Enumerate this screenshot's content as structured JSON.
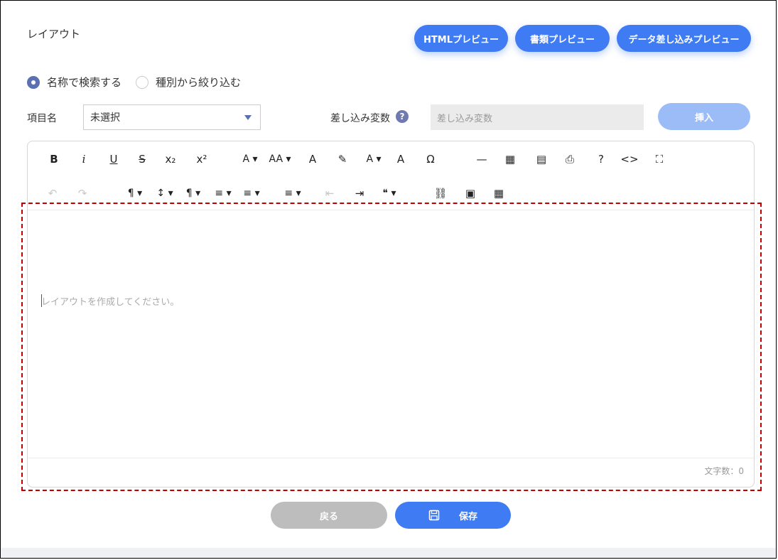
{
  "header": {
    "title": "レイアウト"
  },
  "preview_buttons": {
    "html": "HTMLプレビュー",
    "document": "書類プレビュー",
    "data_merge": "データ差し込みプレビュー"
  },
  "search_mode": {
    "by_name": "名称で検索する",
    "by_type": "種別から絞り込む",
    "selected": "by_name"
  },
  "item": {
    "label": "項目名",
    "value": "未選択"
  },
  "variable": {
    "label": "差し込み変数",
    "help": "?",
    "placeholder": "差し込み変数",
    "insert_label": "挿入"
  },
  "toolbar": {
    "row1": [
      {
        "name": "bold-icon",
        "glyph": "B"
      },
      {
        "name": "italic-icon",
        "glyph": "i"
      },
      {
        "name": "underline-icon",
        "glyph": "U"
      },
      {
        "name": "strikethrough-icon",
        "glyph": "S"
      },
      {
        "name": "subscript-icon",
        "glyph": "x₂"
      },
      {
        "name": "superscript-icon",
        "glyph": "x²"
      },
      {
        "name": "font-family-icon",
        "glyph": "A"
      },
      {
        "name": "font-size-icon",
        "glyph": "AA"
      },
      {
        "name": "text-color-icon",
        "glyph": "A"
      },
      {
        "name": "highlight-icon",
        "glyph": "✎"
      },
      {
        "name": "inline-style-icon",
        "glyph": "A"
      },
      {
        "name": "clear-format-icon",
        "glyph": "A"
      },
      {
        "name": "special-char-icon",
        "glyph": "Ω"
      },
      {
        "name": "horizontal-line-icon",
        "glyph": "—"
      },
      {
        "name": "select-all-icon",
        "glyph": "▦"
      },
      {
        "name": "pdf-icon",
        "glyph": "▤"
      },
      {
        "name": "print-icon",
        "glyph": "⎙"
      },
      {
        "name": "help-icon",
        "glyph": "?"
      },
      {
        "name": "code-view-icon",
        "glyph": "<>"
      },
      {
        "name": "fullscreen-icon",
        "glyph": "⛶"
      }
    ],
    "row2": [
      {
        "name": "undo-icon",
        "glyph": "↶"
      },
      {
        "name": "redo-icon",
        "glyph": "↷"
      },
      {
        "name": "paragraph-format-icon",
        "glyph": "¶"
      },
      {
        "name": "line-height-icon",
        "glyph": "↕"
      },
      {
        "name": "paragraph-style-icon",
        "glyph": "¶"
      },
      {
        "name": "align-icon",
        "glyph": "≡"
      },
      {
        "name": "ordered-list-icon",
        "glyph": "≡"
      },
      {
        "name": "unordered-list-icon",
        "glyph": "≡"
      },
      {
        "name": "outdent-icon",
        "glyph": "⇤"
      },
      {
        "name": "indent-icon",
        "glyph": "⇥"
      },
      {
        "name": "quote-icon",
        "glyph": "❝"
      },
      {
        "name": "link-icon",
        "glyph": "⛓"
      },
      {
        "name": "image-icon",
        "glyph": "▣"
      },
      {
        "name": "table-icon",
        "glyph": "▦"
      }
    ]
  },
  "editor": {
    "placeholder": "レイアウトを作成してください。",
    "char_count": "文字数：0"
  },
  "footer": {
    "back_label": "戻る",
    "save_label": "保存"
  },
  "colors": {
    "primary": "#3f7bf2",
    "primary_light": "#9cbcf7",
    "disabled": "#bdbdbd",
    "highlight_border": "#c00000"
  }
}
